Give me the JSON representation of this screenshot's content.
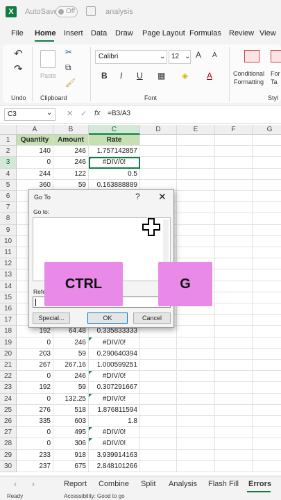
{
  "titlebar": {
    "autosave": "AutoSave",
    "toggle": "Off",
    "filename": "analysis"
  },
  "menu": {
    "tabs": [
      "File",
      "Home",
      "Insert",
      "Data",
      "Draw",
      "Page Layout",
      "Formulas",
      "Review",
      "View"
    ]
  },
  "ribbon": {
    "undo_label": "Undo",
    "clipboard_label": "Clipboard",
    "paste_label": "Paste",
    "font_name": "Calibri",
    "font_size": "12",
    "font_label": "Font",
    "bold": "B",
    "italic": "I",
    "underline": "U",
    "grow": "A",
    "shrink": "A",
    "cond_format": "Conditional",
    "cond_format2": "Formatting",
    "format_table": "For",
    "format_table2": "Ta",
    "styles_label": "Styl"
  },
  "formula_bar": {
    "namebox": "C3",
    "formula": "=B3/A3"
  },
  "grid": {
    "columns": [
      "A",
      "B",
      "C",
      "D",
      "E",
      "F",
      "G"
    ],
    "header": [
      "Quantity",
      "Amount",
      "Rate"
    ],
    "rows": [
      [
        "140",
        "246",
        "1.757142857"
      ],
      [
        "0",
        "246",
        "#DIV/0!"
      ],
      [
        "244",
        "122",
        "0.5"
      ],
      [
        "360",
        "59",
        "0.163888889"
      ],
      [
        "",
        "",
        ""
      ],
      [
        "",
        "",
        ""
      ],
      [
        "",
        "",
        ""
      ],
      [
        "",
        "",
        ""
      ],
      [
        "",
        "",
        ""
      ],
      [
        "",
        "",
        ""
      ],
      [
        "",
        "",
        ""
      ],
      [
        "",
        "",
        ""
      ],
      [
        "",
        "",
        ""
      ],
      [
        "",
        "",
        ""
      ],
      [
        "",
        "",
        ""
      ],
      [
        "",
        "",
        ""
      ],
      [
        "192",
        "64.48",
        "0.335833333"
      ],
      [
        "0",
        "246",
        "#DIV/0!"
      ],
      [
        "203",
        "59",
        "0.290640394"
      ],
      [
        "267",
        "267.16",
        "1.000599251"
      ],
      [
        "0",
        "246",
        "#DIV/0!"
      ],
      [
        "192",
        "59",
        "0.307291667"
      ],
      [
        "0",
        "132.25",
        "#DIV/0!"
      ],
      [
        "276",
        "518",
        "1.876811594"
      ],
      [
        "335",
        "603",
        "1.8"
      ],
      [
        "0",
        "495",
        "#DIV/0!"
      ],
      [
        "0",
        "306",
        "#DIV/0!"
      ],
      [
        "233",
        "918",
        "3.939914163"
      ],
      [
        "237",
        "675",
        "2.848101266"
      ]
    ]
  },
  "dialog": {
    "title": "Go To",
    "help": "?",
    "close": "✕",
    "goto_label": "Go to:",
    "reference_label": "Refe",
    "special_button": "Special...",
    "ok_button": "OK",
    "cancel_button": "Cancel"
  },
  "keys": {
    "ctrl": "CTRL",
    "g": "G"
  },
  "sheets": {
    "tabs": [
      "Report",
      "Combine",
      "Split",
      "Analysis",
      "Flash Fill",
      "Errors"
    ]
  },
  "status": {
    "ready": "Ready",
    "accessibility": "Accessibility: Good to go"
  }
}
